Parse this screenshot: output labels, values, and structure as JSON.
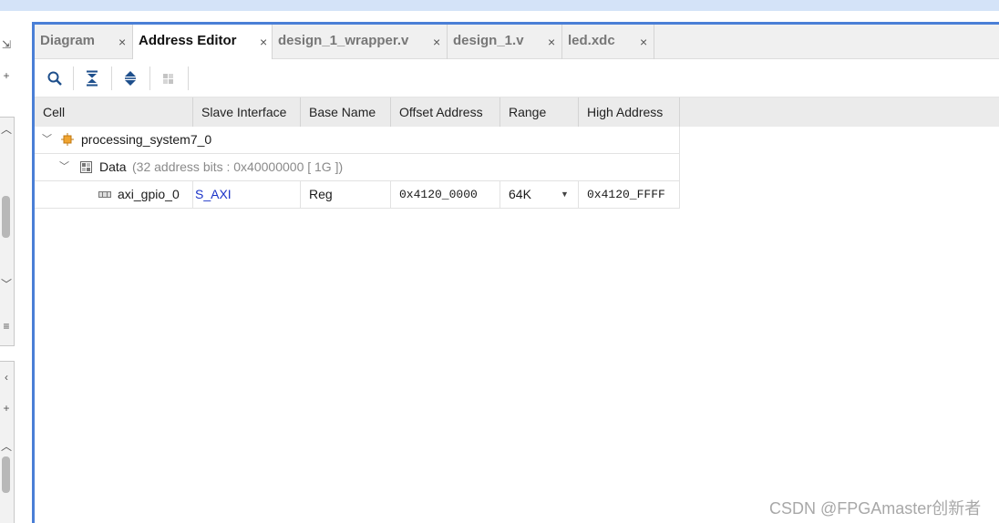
{
  "tabs": [
    {
      "label": "Diagram",
      "close": "×"
    },
    {
      "label": "Address Editor",
      "close": "×"
    },
    {
      "label": "design_1_wrapper.v",
      "close": "×"
    },
    {
      "label": "design_1.v",
      "close": "×"
    },
    {
      "label": "led.xdc",
      "close": "×"
    }
  ],
  "active_tab": "Address Editor",
  "toolbar": {
    "icons": [
      "search-icon",
      "collapse-all-icon",
      "expand-all-icon",
      "auto-assign-icon"
    ]
  },
  "table": {
    "columns": [
      "Cell",
      "Slave Interface",
      "Base Name",
      "Offset Address",
      "Range",
      "High Address"
    ],
    "root": {
      "label": "processing_system7_0"
    },
    "segment": {
      "label": "Data",
      "detail": "(32 address bits : 0x40000000 [ 1G ])"
    },
    "row": {
      "cell": "axi_gpio_0",
      "slave_interface": "S_AXI",
      "base_name": "Reg",
      "offset": "0x4120_0000",
      "range": "64K",
      "high": "0x4120_FFFF"
    }
  },
  "watermark": "CSDN @FPGAmaster创新者",
  "colors": {
    "accent": "#4a7fd6",
    "link": "#1a33c8"
  }
}
